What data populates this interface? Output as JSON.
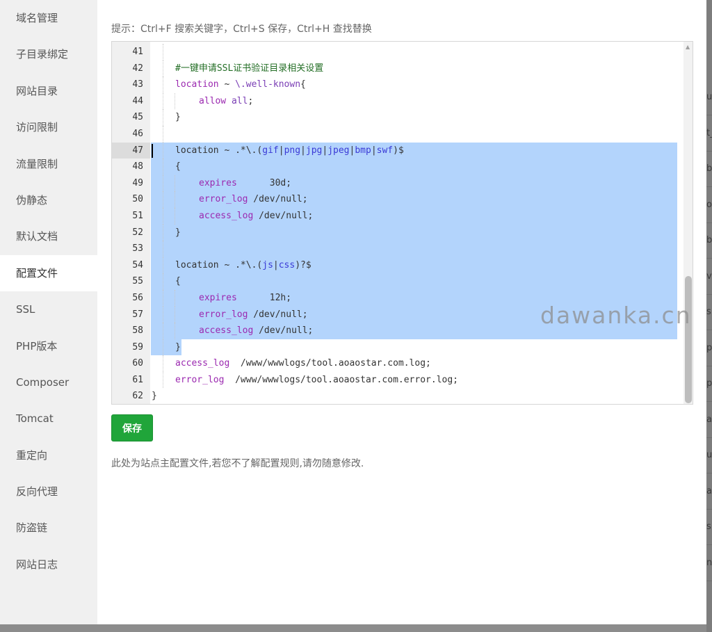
{
  "sidebar": {
    "items": [
      {
        "label": "域名管理"
      },
      {
        "label": "子目录绑定"
      },
      {
        "label": "网站目录"
      },
      {
        "label": "访问限制"
      },
      {
        "label": "流量限制"
      },
      {
        "label": "伪静态"
      },
      {
        "label": "默认文档"
      },
      {
        "label": "配置文件",
        "active": true
      },
      {
        "label": "SSL"
      },
      {
        "label": "PHP版本"
      },
      {
        "label": "Composer"
      },
      {
        "label": "Tomcat"
      },
      {
        "label": "重定向"
      },
      {
        "label": "反向代理"
      },
      {
        "label": "防盗链"
      },
      {
        "label": "网站日志"
      }
    ]
  },
  "hint": "提示：Ctrl+F 搜索关键字，Ctrl+S 保存，Ctrl+H 查找替换",
  "editor": {
    "lines": [
      {
        "num": "41",
        "depth": 1,
        "sel": "none",
        "tokens": []
      },
      {
        "num": "42",
        "depth": 1,
        "sel": "none",
        "tokens": [
          {
            "t": "#一键申请SSL证书验证目录相关设置",
            "c": "cm"
          }
        ]
      },
      {
        "num": "43",
        "depth": 1,
        "sel": "none",
        "tokens": [
          {
            "t": "location",
            "c": "kw"
          },
          {
            "t": " ~ ",
            "c": "tx"
          },
          {
            "t": "\\.well-known",
            "c": "kw2"
          },
          {
            "t": "{",
            "c": "tx"
          }
        ]
      },
      {
        "num": "44",
        "depth": 2,
        "sel": "none",
        "tokens": [
          {
            "t": "allow",
            "c": "kw"
          },
          {
            "t": " ",
            "c": "tx"
          },
          {
            "t": "all",
            "c": "kw2"
          },
          {
            "t": ";",
            "c": "tx"
          }
        ]
      },
      {
        "num": "45",
        "depth": 1,
        "sel": "none",
        "tokens": [
          {
            "t": "}",
            "c": "tx"
          }
        ]
      },
      {
        "num": "46",
        "depth": 1,
        "sel": "none",
        "tokens": []
      },
      {
        "num": "47",
        "depth": 1,
        "sel": "full",
        "caret": true,
        "tokens": [
          {
            "t": "location",
            "c": "tx"
          },
          {
            "t": " ~ .*\\.(",
            "c": "tx"
          },
          {
            "t": "gif",
            "c": "re"
          },
          {
            "t": "|",
            "c": "tx"
          },
          {
            "t": "png",
            "c": "re"
          },
          {
            "t": "|",
            "c": "tx"
          },
          {
            "t": "jpg",
            "c": "re"
          },
          {
            "t": "|",
            "c": "tx"
          },
          {
            "t": "jpeg",
            "c": "re"
          },
          {
            "t": "|",
            "c": "tx"
          },
          {
            "t": "bmp",
            "c": "re"
          },
          {
            "t": "|",
            "c": "tx"
          },
          {
            "t": "swf",
            "c": "re"
          },
          {
            "t": ")$",
            "c": "tx"
          }
        ]
      },
      {
        "num": "48",
        "depth": 1,
        "sel": "full",
        "tokens": [
          {
            "t": "{",
            "c": "tx"
          }
        ]
      },
      {
        "num": "49",
        "depth": 2,
        "sel": "full",
        "tokens": [
          {
            "t": "expires",
            "c": "kw"
          },
          {
            "t": "      30d;",
            "c": "tx"
          }
        ]
      },
      {
        "num": "50",
        "depth": 2,
        "sel": "full",
        "tokens": [
          {
            "t": "error_log",
            "c": "kw"
          },
          {
            "t": " /dev/null;",
            "c": "tx"
          }
        ]
      },
      {
        "num": "51",
        "depth": 2,
        "sel": "full",
        "tokens": [
          {
            "t": "access_log",
            "c": "kw"
          },
          {
            "t": " /dev/null;",
            "c": "tx"
          }
        ]
      },
      {
        "num": "52",
        "depth": 1,
        "sel": "full",
        "tokens": [
          {
            "t": "}",
            "c": "tx"
          }
        ]
      },
      {
        "num": "53",
        "depth": 1,
        "sel": "full",
        "tokens": []
      },
      {
        "num": "54",
        "depth": 1,
        "sel": "full",
        "tokens": [
          {
            "t": "location",
            "c": "tx"
          },
          {
            "t": " ~ .*\\.(",
            "c": "tx"
          },
          {
            "t": "js",
            "c": "re"
          },
          {
            "t": "|",
            "c": "tx"
          },
          {
            "t": "css",
            "c": "re"
          },
          {
            "t": ")?$",
            "c": "tx"
          }
        ]
      },
      {
        "num": "55",
        "depth": 1,
        "sel": "full",
        "tokens": [
          {
            "t": "{",
            "c": "tx"
          }
        ]
      },
      {
        "num": "56",
        "depth": 2,
        "sel": "full",
        "tokens": [
          {
            "t": "expires",
            "c": "kw"
          },
          {
            "t": "      12h;",
            "c": "tx"
          }
        ]
      },
      {
        "num": "57",
        "depth": 2,
        "sel": "full",
        "tokens": [
          {
            "t": "error_log",
            "c": "kw"
          },
          {
            "t": " /dev/null;",
            "c": "tx"
          }
        ]
      },
      {
        "num": "58",
        "depth": 2,
        "sel": "full",
        "tokens": [
          {
            "t": "access_log",
            "c": "kw"
          },
          {
            "t": " /dev/null;",
            "c": "tx"
          }
        ]
      },
      {
        "num": "59",
        "depth": 1,
        "sel": "partial",
        "tokens": [
          {
            "t": "}",
            "c": "tx"
          }
        ]
      },
      {
        "num": "60",
        "depth": 1,
        "sel": "none",
        "tokens": [
          {
            "t": "access_log",
            "c": "kw"
          },
          {
            "t": "  /www/wwwlogs/tool.aoaostar.com.log;",
            "c": "tx"
          }
        ]
      },
      {
        "num": "61",
        "depth": 1,
        "sel": "none",
        "tokens": [
          {
            "t": "error_log",
            "c": "kw"
          },
          {
            "t": "  /www/wwwlogs/tool.aoaostar.com.error.log;",
            "c": "tx"
          }
        ]
      },
      {
        "num": "62",
        "depth": 0,
        "sel": "none",
        "tokens": [
          {
            "t": "}",
            "c": "tx"
          }
        ]
      }
    ]
  },
  "watermark": "dawanka.cn",
  "save_label": "保存",
  "note": "此处为站点主配置文件,若您不了解配置规则,请勿随意修改.",
  "background_fragments": [
    "u",
    "t_",
    "b",
    "o",
    "b",
    "v",
    "s",
    "p",
    "p",
    "a",
    "u",
    "a",
    "s",
    "n"
  ],
  "colors": {
    "save_button": "#20a53a",
    "selection": "#b3d4fc",
    "comment": "#236e25",
    "keyword": "#9b29b0",
    "regex_alt": "#3a3ad6"
  }
}
